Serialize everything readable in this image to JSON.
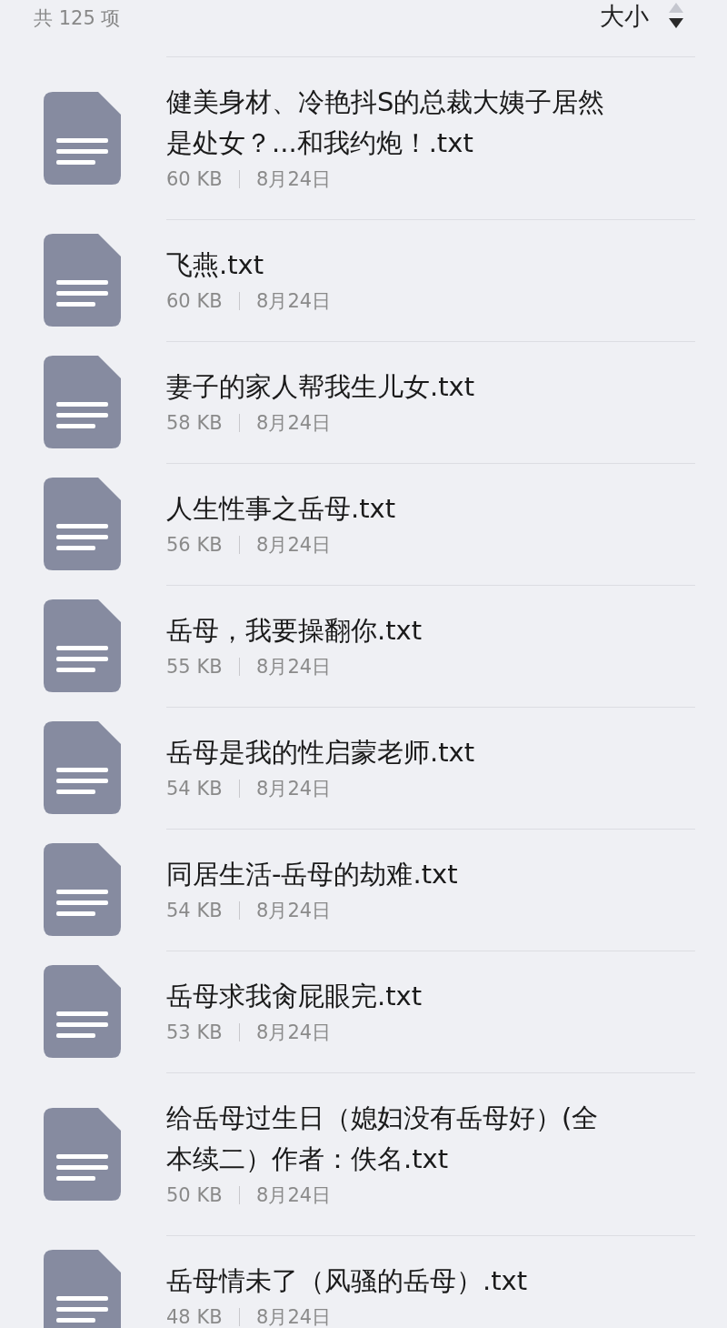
{
  "header": {
    "count": "共 125 项",
    "sort_label": "大小"
  },
  "files": [
    {
      "name": "健美身材、冷艳抖S的总裁大姨子居然是处女？...和我约炮！.txt",
      "size": "60 KB",
      "date": "8月24日"
    },
    {
      "name": "飞燕.txt",
      "size": "60 KB",
      "date": "8月24日"
    },
    {
      "name": "妻子的家人帮我生儿女.txt",
      "size": "58 KB",
      "date": "8月24日"
    },
    {
      "name": "人生性事之岳母.txt",
      "size": "56 KB",
      "date": "8月24日"
    },
    {
      "name": "岳母，我要操翻你.txt",
      "size": "55 KB",
      "date": "8月24日"
    },
    {
      "name": "岳母是我的性启蒙老师.txt",
      "size": "54 KB",
      "date": "8月24日"
    },
    {
      "name": "同居生活-岳母的劫难.txt",
      "size": "54 KB",
      "date": "8月24日"
    },
    {
      "name": "岳母求我肏屁眼完.txt",
      "size": "53 KB",
      "date": "8月24日"
    },
    {
      "name": "给岳母过生日（媳妇没有岳母好）(全本续二）作者：佚名.txt",
      "size": "50 KB",
      "date": "8月24日"
    },
    {
      "name": "岳母情未了（风骚的岳母）.txt",
      "size": "48 KB",
      "date": "8月24日"
    }
  ]
}
